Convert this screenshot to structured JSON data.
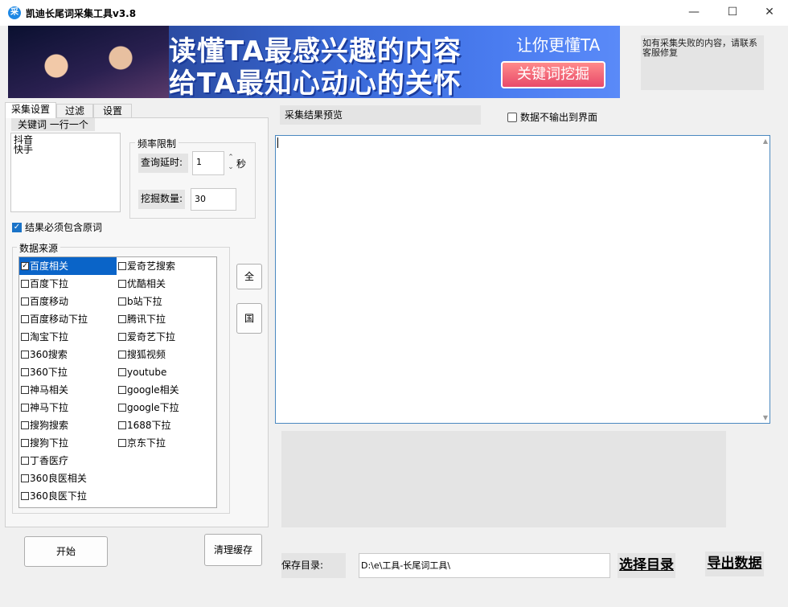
{
  "window": {
    "title": "凯迪长尾词采集工具v3.8",
    "icon_glyph": "采",
    "minimize_glyph": "—",
    "maximize_glyph": "☐",
    "close_glyph": "✕"
  },
  "banner": {
    "line1": "读懂TA最感兴趣的内容",
    "line2": "给TA最知心动心的关怀",
    "subtitle": "让你更懂TA",
    "button": "关键词挖掘"
  },
  "notice": "如有采集失败的内容，请联系客服修复",
  "tabs": [
    "采集设置",
    "过滤",
    "设置"
  ],
  "keyword": {
    "label": "关键词 一行一个",
    "value": "抖音\n快手"
  },
  "frequency": {
    "title": "频率限制",
    "delay_label": "查询延时:",
    "delay_value": "1",
    "delay_unit": "秒",
    "count_label": "挖掘数量:",
    "count_value": "30"
  },
  "must_contain": {
    "label": "结果必须包含原词",
    "checked": true
  },
  "sources": {
    "title": "数据来源",
    "left": [
      {
        "label": "百度相关",
        "checked": true,
        "selected": true
      },
      {
        "label": "百度下拉",
        "checked": false
      },
      {
        "label": "百度移动",
        "checked": false
      },
      {
        "label": "百度移动下拉",
        "checked": false
      },
      {
        "label": "淘宝下拉",
        "checked": false
      },
      {
        "label": "360搜索",
        "checked": false
      },
      {
        "label": "360下拉",
        "checked": false
      },
      {
        "label": "神马相关",
        "checked": false
      },
      {
        "label": "神马下拉",
        "checked": false
      },
      {
        "label": "搜狗搜索",
        "checked": false
      },
      {
        "label": "搜狗下拉",
        "checked": false
      },
      {
        "label": "丁香医疗",
        "checked": false
      },
      {
        "label": "360良医相关",
        "checked": false
      },
      {
        "label": "360良医下拉",
        "checked": false
      }
    ],
    "right": [
      {
        "label": "爱奇艺搜索",
        "checked": false
      },
      {
        "label": "优酷相关",
        "checked": false
      },
      {
        "label": "b站下拉",
        "checked": false
      },
      {
        "label": "腾讯下拉",
        "checked": false
      },
      {
        "label": "爱奇艺下拉",
        "checked": false
      },
      {
        "label": "搜狐视频",
        "checked": false
      },
      {
        "label": "youtube",
        "checked": false
      },
      {
        "label": "google相关",
        "checked": false
      },
      {
        "label": "google下拉",
        "checked": false
      },
      {
        "label": "1688下拉",
        "checked": false
      },
      {
        "label": "京东下拉",
        "checked": false
      }
    ]
  },
  "side_buttons": {
    "all": "全",
    "country": "国"
  },
  "buttons": {
    "start": "开始",
    "clear_cache": "清理缓存"
  },
  "preview": {
    "label": "采集结果预览",
    "no_output_label": "数据不输出到界面",
    "no_output_checked": false
  },
  "save": {
    "label": "保存目录:",
    "path": "D:\\e\\工具-长尾词工具\\",
    "choose_dir": "选择目录",
    "export": "导出数据"
  }
}
